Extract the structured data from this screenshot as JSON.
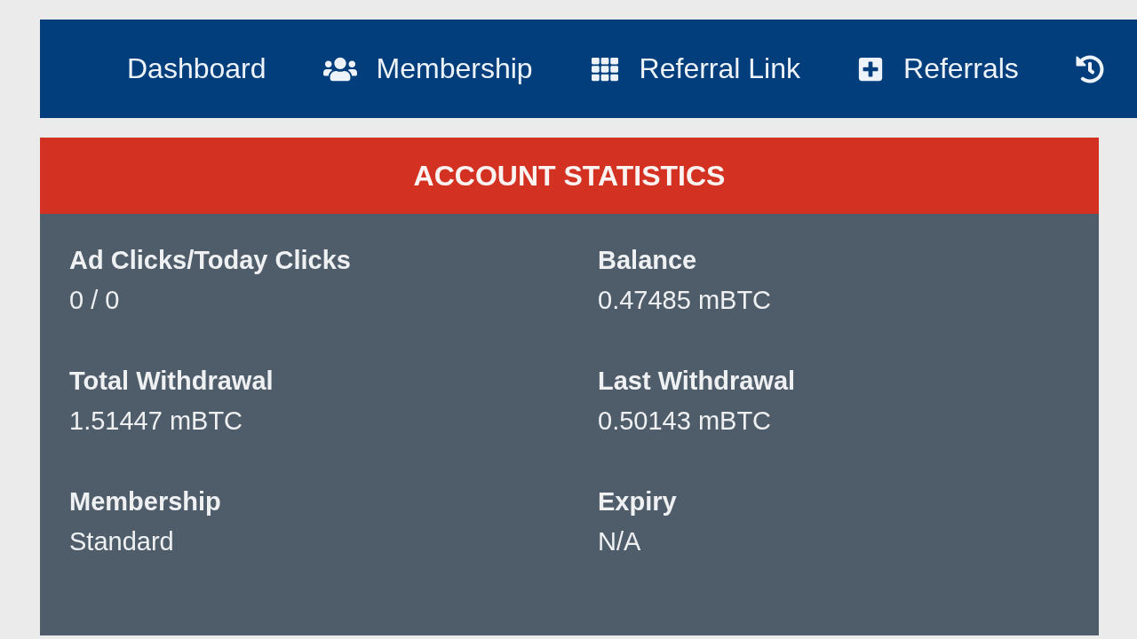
{
  "nav": {
    "items": [
      {
        "label": "Dashboard"
      },
      {
        "label": "Membership"
      },
      {
        "label": "Referral Link"
      },
      {
        "label": "Referrals"
      }
    ]
  },
  "account_statistics": {
    "title": "ACCOUNT STATISTICS",
    "stats": [
      {
        "label": "Ad Clicks/Today Clicks",
        "value": "0 / 0"
      },
      {
        "label": "Balance",
        "value": "0.47485 mBTC"
      },
      {
        "label": "Total Withdrawal",
        "value": "1.51447 mBTC"
      },
      {
        "label": "Last Withdrawal",
        "value": "0.50143 mBTC"
      },
      {
        "label": "Membership",
        "value": "Standard"
      },
      {
        "label": "Expiry",
        "value": "N/A"
      }
    ]
  }
}
